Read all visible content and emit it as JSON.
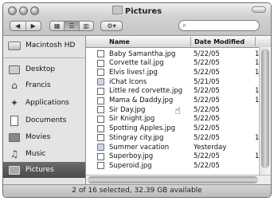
{
  "window": {
    "title": "Pictures"
  },
  "toolbar": {
    "back_label": "◀",
    "forward_label": "▶",
    "view_icons_label": "▦",
    "view_list_label": "☰",
    "view_columns_label": "▥",
    "action_label": "⚙▾",
    "search_icon": "⌕",
    "search_placeholder": ""
  },
  "sidebar": {
    "items": [
      {
        "label": "Macintosh HD",
        "icon": "hard-drive-icon"
      },
      {
        "label": "Desktop",
        "icon": "desktop-icon"
      },
      {
        "label": "Francis",
        "icon": "home-icon"
      },
      {
        "label": "Applications",
        "icon": "applications-icon"
      },
      {
        "label": "Documents",
        "icon": "documents-icon"
      },
      {
        "label": "Movies",
        "icon": "movies-icon"
      },
      {
        "label": "Music",
        "icon": "music-icon"
      },
      {
        "label": "Pictures",
        "icon": "pictures-icon",
        "selected": true
      }
    ]
  },
  "list": {
    "columns": {
      "name": "Name",
      "date": "Date Modified"
    },
    "rows": [
      {
        "name": "Baby Samantha.jpg",
        "date": "5/22/05",
        "extra": "1",
        "kind": "image"
      },
      {
        "name": "Corvette tail.jpg",
        "date": "5/22/05",
        "extra": "1",
        "kind": "image"
      },
      {
        "name": "Elvis lives!.jpg",
        "date": "5/22/05",
        "extra": "1",
        "kind": "image"
      },
      {
        "name": "iChat Icons",
        "date": "5/21/05",
        "extra": "",
        "kind": "folder"
      },
      {
        "name": "Little red corvette.jpg",
        "date": "5/22/05",
        "extra": "1",
        "kind": "image"
      },
      {
        "name": "Mama & Daddy.jpg",
        "date": "5/22/05",
        "extra": "1",
        "kind": "image"
      },
      {
        "name": "Sir Day.jpg",
        "date": "5/22/05",
        "extra": "",
        "kind": "image"
      },
      {
        "name": "Sir Knight.jpg",
        "date": "5/22/05",
        "extra": "",
        "kind": "image"
      },
      {
        "name": "Spotting Apples.jpg",
        "date": "5/22/05",
        "extra": "",
        "kind": "image"
      },
      {
        "name": "Stingray city.jpg",
        "date": "5/22/05",
        "extra": "1",
        "kind": "image"
      },
      {
        "name": "Summer vacation",
        "date": "Yesterday",
        "extra": "",
        "kind": "folder"
      },
      {
        "name": "Superboy.jpg",
        "date": "5/22/05",
        "extra": "1",
        "kind": "image"
      },
      {
        "name": "Superoid.jpg",
        "date": "5/22/05",
        "extra": "",
        "kind": "image"
      }
    ]
  },
  "status": {
    "text": "2 of 16 selected, 32.39 GB available"
  },
  "cursor_glyph": "☝"
}
